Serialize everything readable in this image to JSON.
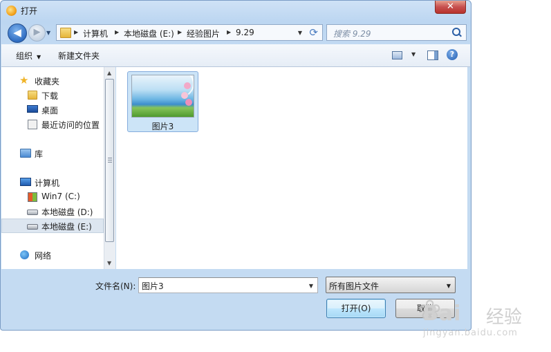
{
  "window": {
    "title": "打开",
    "close_glyph": "✕"
  },
  "nav": {
    "back_glyph": "◀",
    "forward_glyph": "▶",
    "breadcrumbs": [
      "计算机",
      "本地磁盘 (E:)",
      "经验图片",
      "9.29"
    ],
    "search_placeholder": "搜索 9.29",
    "refresh_glyph": "⟳"
  },
  "toolbar": {
    "organize": "组织",
    "new_folder": "新建文件夹",
    "help": "?"
  },
  "sidebar": {
    "items": [
      {
        "label": "收藏夹",
        "icon": "star-icon"
      },
      {
        "label": "下载",
        "icon": "downloads-folder-icon"
      },
      {
        "label": "桌面",
        "icon": "desktop-icon"
      },
      {
        "label": "最近访问的位置",
        "icon": "recent-places-icon"
      },
      {
        "label": "库",
        "icon": "library-icon"
      },
      {
        "label": "计算机",
        "icon": "computer-icon"
      },
      {
        "label": "Win7 (C:)",
        "icon": "windows-drive-icon"
      },
      {
        "label": "本地磁盘 (D:)",
        "icon": "drive-icon"
      },
      {
        "label": "本地磁盘 (E:)",
        "icon": "drive-icon",
        "selected": true
      },
      {
        "label": "网络",
        "icon": "network-icon"
      }
    ]
  },
  "files": [
    {
      "name": "图片3",
      "type": "image-thumbnail",
      "selected": true
    }
  ],
  "footer": {
    "filename_label": "文件名(N):",
    "filename_value": "图片3",
    "filetype_value": "所有图片文件",
    "open_button": "打开(O)",
    "cancel_button": "取消"
  },
  "watermark": {
    "brand": "Bai",
    "brand_cn": "经验",
    "url": "jingyan.baidu.com"
  },
  "colors": {
    "selection": "#cce4f7",
    "accent": "#3c7fb1",
    "title_bg": "#c4dbf2"
  }
}
